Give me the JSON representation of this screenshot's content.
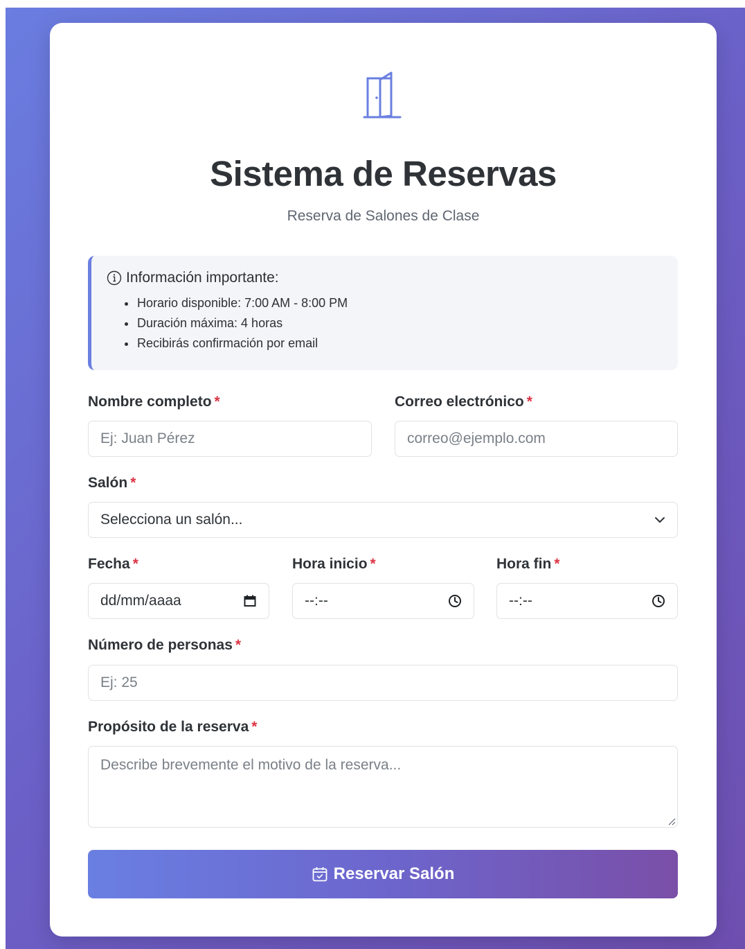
{
  "header": {
    "title": "Sistema de Reservas",
    "subtitle": "Reserva de Salones de Clase",
    "logo_icon": "door-icon"
  },
  "info": {
    "heading": "Información importante:",
    "icon": "info-circle-icon",
    "items": [
      "Horario disponible: 7:00 AM - 8:00 PM",
      "Duración máxima: 4 horas",
      "Recibirás confirmación por email"
    ]
  },
  "form": {
    "required_mark": "*",
    "name": {
      "label": "Nombre completo",
      "placeholder": "Ej: Juan Pérez"
    },
    "email": {
      "label": "Correo electrónico",
      "placeholder": "correo@ejemplo.com"
    },
    "room": {
      "label": "Salón",
      "value": "Selecciona un salón..."
    },
    "date": {
      "label": "Fecha",
      "value": "dd/mm/aaaa"
    },
    "start": {
      "label": "Hora inicio",
      "value": "--:--"
    },
    "end": {
      "label": "Hora fin",
      "value": "--:--"
    },
    "people": {
      "label": "Número de personas",
      "placeholder": "Ej: 25"
    },
    "purpose": {
      "label": "Propósito de la reserva",
      "placeholder": "Describe brevemente el motivo de la reserva..."
    },
    "submit_label": "Reservar Salón"
  },
  "colors": {
    "accent": "#6a7fe0",
    "accent_end": "#7a4fa8",
    "required": "#dc3545"
  }
}
